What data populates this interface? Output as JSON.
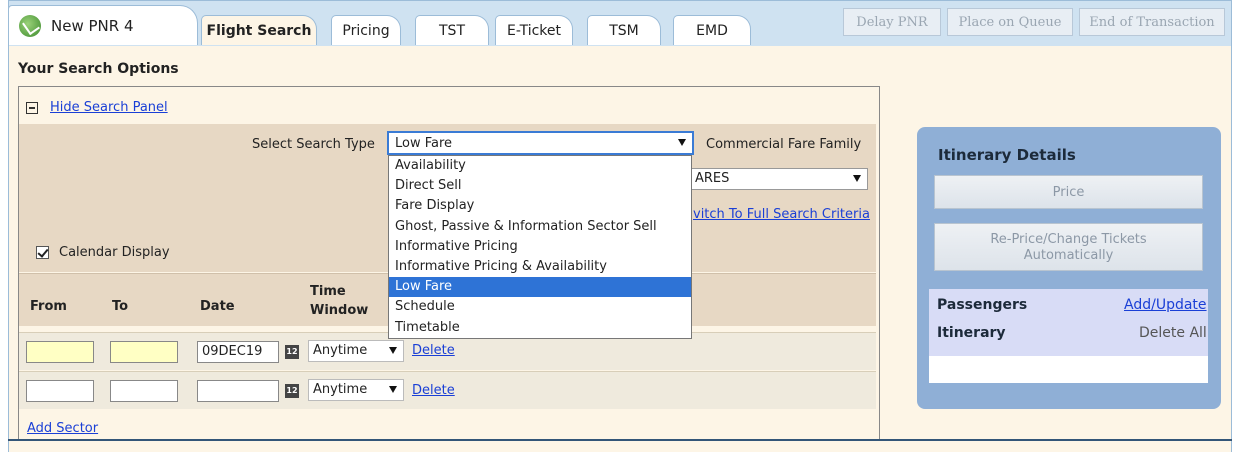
{
  "header": {
    "pnr_tab": "New PNR 4",
    "tabs": [
      "Flight Search",
      "Pricing",
      "TST",
      "E-Ticket",
      "TSM",
      "EMD"
    ],
    "actions": [
      "Delay PNR",
      "Place on Queue",
      "End of Transaction"
    ]
  },
  "search": {
    "title": "Your Search Options",
    "hide_panel": "Hide Search Panel",
    "select_type_label": "Select Search Type",
    "select_type_value": "Low Fare",
    "fare_family_label": "Commercial Fare Family",
    "fare_family_value": "ARES",
    "switch_link": "vitch To Full Search Criteria",
    "calendar_display": "Calendar Display",
    "options": [
      "Availability",
      "Direct Sell",
      "Fare Display",
      "Ghost, Passive & Information Sector Sell",
      "Informative Pricing",
      "Informative Pricing & Availability",
      "Low Fare",
      "Schedule",
      "Timetable"
    ],
    "selected_option": "Low Fare"
  },
  "sectors": {
    "headers": {
      "from": "From",
      "to": "To",
      "date": "Date",
      "time_window_1": "Time",
      "time_window_2": "Window"
    },
    "rows": [
      {
        "from": "",
        "to": "",
        "date": "09DEC19",
        "time": "Anytime",
        "delete": "Delete"
      },
      {
        "from": "",
        "to": "",
        "date": "",
        "time": "Anytime",
        "delete": "Delete"
      }
    ],
    "calendar_icon": "12",
    "add_sector": "Add Sector"
  },
  "itinerary": {
    "title": "Itinerary Details",
    "price_btn": "Price",
    "reprice_btn_1": "Re-Price/Change Tickets",
    "reprice_btn_2": "Automatically",
    "passengers": "Passengers",
    "add_update": "Add/Update",
    "itinerary_label": "Itinerary",
    "delete_all": "Delete All"
  }
}
